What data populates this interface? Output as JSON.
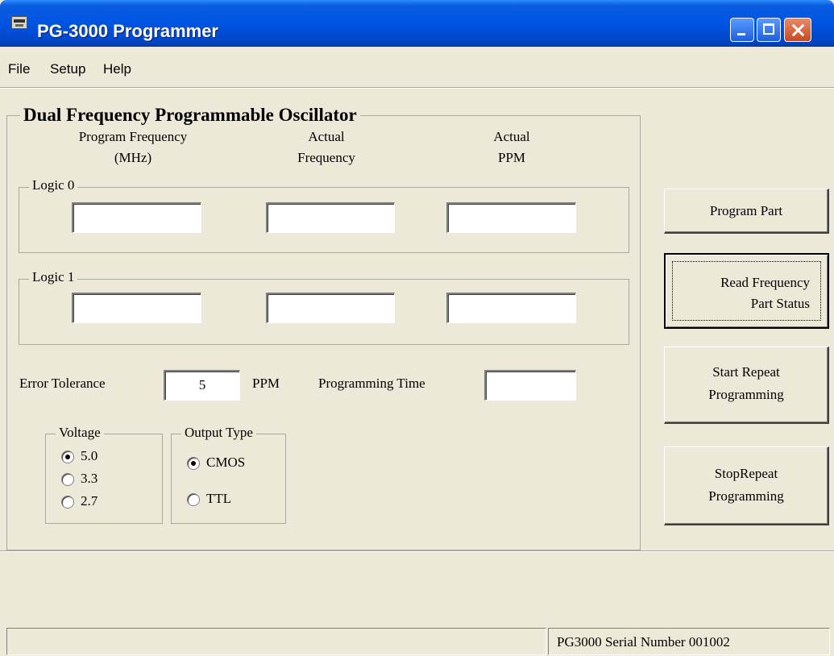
{
  "window": {
    "title": "PG-3000 Programmer"
  },
  "menu": {
    "file": "File",
    "setup": "Setup",
    "help": "Help"
  },
  "main_group": {
    "title": "Dual Frequency Programmable Oscillator",
    "col_program_freq_line1": "Program Frequency",
    "col_program_freq_line2": "(MHz)",
    "col_actual_freq_line1": "Actual",
    "col_actual_freq_line2": "Frequency",
    "col_actual_ppm_line1": "Actual",
    "col_actual_ppm_line2": "PPM"
  },
  "logic0": {
    "label": "Logic 0",
    "program_frequency": "",
    "actual_frequency": "",
    "actual_ppm": ""
  },
  "logic1": {
    "label": "Logic 1",
    "program_frequency": "",
    "actual_frequency": "",
    "actual_ppm": ""
  },
  "error_tolerance": {
    "label": "Error Tolerance",
    "value": "5",
    "unit": "PPM"
  },
  "programming_time": {
    "label": "Programming Time",
    "value": ""
  },
  "voltage": {
    "title": "Voltage",
    "options": [
      "5.0",
      "3.3",
      "2.7"
    ],
    "selected": "5.0"
  },
  "output_type": {
    "title": "Output Type",
    "options": [
      "CMOS",
      "TTL"
    ],
    "selected": "CMOS"
  },
  "buttons": {
    "program_part": "Program Part",
    "read_frequency_line1": "Read Frequency",
    "read_frequency_line2": "Part Status",
    "start_repeat_line1": "Start Repeat",
    "start_repeat_line2": "Programming",
    "stop_repeat_line1": "StopRepeat",
    "stop_repeat_line2": "Programming"
  },
  "status": {
    "serial": "PG3000 Serial Number 001002"
  }
}
